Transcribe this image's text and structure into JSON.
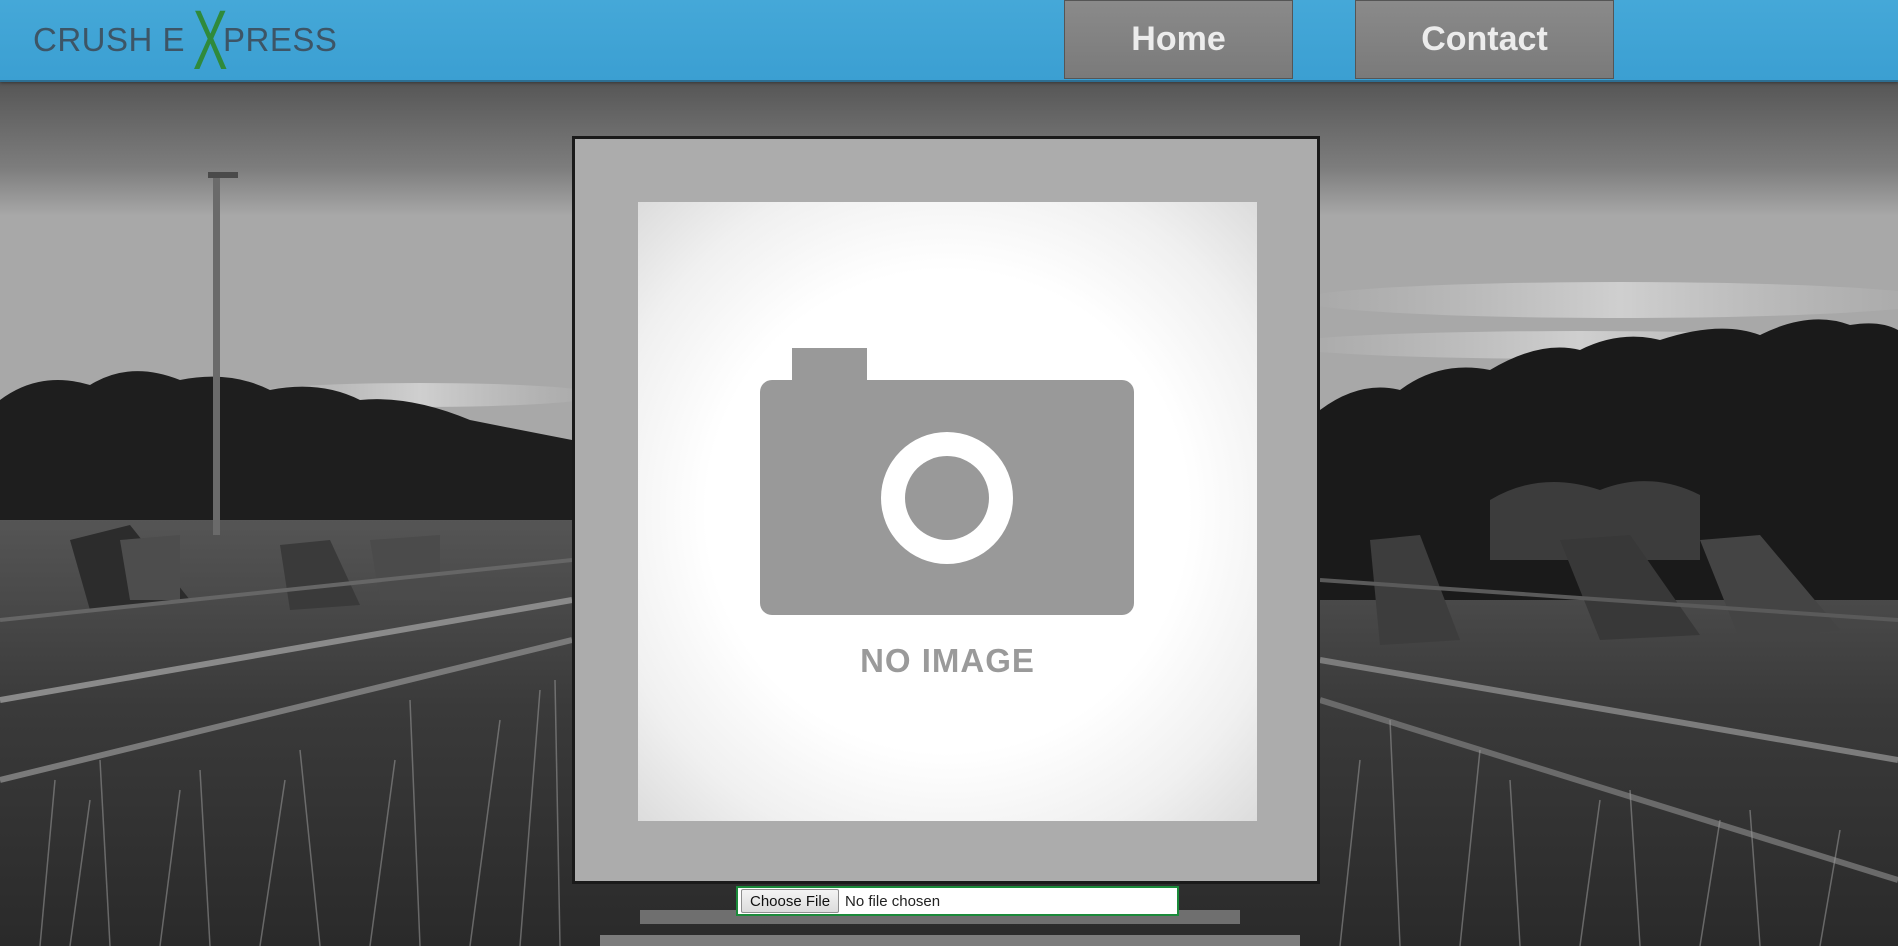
{
  "header": {
    "logo": {
      "part1": "CRUSH E",
      "x_letter": "X",
      "part2": "PRESS"
    },
    "nav": {
      "home_label": "Home",
      "contact_label": "Contact"
    }
  },
  "preview": {
    "placeholder_text": "NO IMAGE",
    "icon": "camera-icon"
  },
  "file_input": {
    "button_label": "Choose File",
    "status_text": "No file chosen"
  },
  "colors": {
    "header_bg": "#3ea3d6",
    "nav_button_bg": "#828282",
    "logo_text": "#3d5566",
    "logo_accent": "#2f8a3c",
    "file_input_border": "#1b8a3a",
    "panel_bg": "#acacac"
  }
}
